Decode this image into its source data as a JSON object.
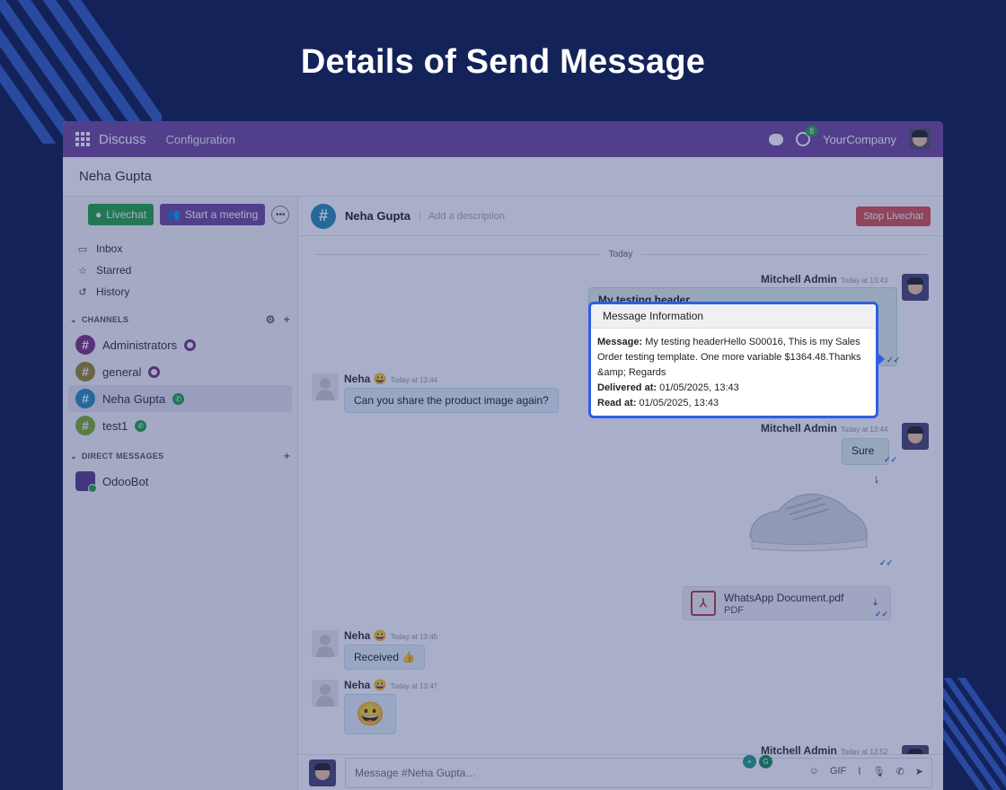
{
  "headline": "Details of Send Message",
  "navbar": {
    "app_name": "Discuss",
    "menu": "Configuration",
    "activity_count": "8",
    "company": "YourCompany"
  },
  "subheader": {
    "title": "Neha Gupta"
  },
  "sidebar": {
    "livechat_button": "Livechat",
    "meeting_button": "Start a meeting",
    "mailboxes": [
      {
        "label": "Inbox",
        "icon": "inbox-icon"
      },
      {
        "label": "Starred",
        "icon": "star-icon"
      },
      {
        "label": "History",
        "icon": "history-icon"
      }
    ],
    "channels_heading": "CHANNELS",
    "channels": [
      {
        "label": "Administrators",
        "color": "#7c3480",
        "badge": "ring"
      },
      {
        "label": "general",
        "color": "#9a8a2a",
        "badge": "ring"
      },
      {
        "label": "Neha Gupta",
        "color": "#2a8fb5",
        "badge": "whatsapp"
      },
      {
        "label": "test1",
        "color": "#7fae2c",
        "badge": "whatsapp"
      }
    ],
    "dm_heading": "DIRECT MESSAGES",
    "direct_messages": [
      {
        "label": "OdooBot"
      }
    ]
  },
  "thread": {
    "name": "Neha Gupta",
    "description_placeholder": "Add a description",
    "stop_button": "Stop Livechat",
    "day_separator": "Today",
    "messages": [
      {
        "author": "Mitchell Admin",
        "time": "Today at 13:43",
        "text": "My testing header"
      },
      {
        "author": "Neha 😀",
        "time": "Today at 13:44",
        "text": "Can you share the product image again?"
      },
      {
        "author": "Mitchell Admin",
        "time": "Today at 13:44",
        "text": "Sure"
      },
      {
        "author": "Neha 😀",
        "time": "Today at 13:45",
        "text": "Received 👍"
      },
      {
        "author": "Neha 😀",
        "time": "Today at 13:47",
        "text": "😀"
      },
      {
        "author": "Mitchell Admin",
        "time": "Today at 13:52",
        "text": ""
      }
    ],
    "attachment": {
      "name": "WhatsApp Document.pdf",
      "type": "PDF"
    }
  },
  "composer": {
    "placeholder": "Message #Neha Gupta…",
    "tools": [
      "emoji-icon",
      "gif-icon",
      "paperclip-icon",
      "microphone-icon",
      "whatsapp-icon",
      "send-icon"
    ],
    "gif_label": "GIF"
  },
  "popover": {
    "title": "Message Information",
    "message_label": "Message:",
    "message_value": "My testing headerHello S00016, This is my Sales Order testing template. One more variable $1364.48.Thanks &amp; Regards",
    "delivered_label": "Delivered at:",
    "delivered_value": "01/05/2025, 13:43",
    "read_label": "Read at:",
    "read_value": "01/05/2025, 13:43"
  },
  "colors": {
    "page_bg": "#13235a",
    "navbar": "#714b9d",
    "highlight": "#2f5fe0",
    "stop_button": "#d9534f",
    "livechat": "#28a745"
  }
}
